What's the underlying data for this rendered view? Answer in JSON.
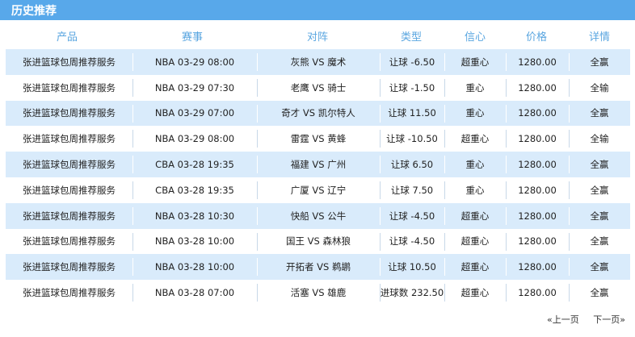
{
  "header": {
    "title": "历史推荐"
  },
  "columns": [
    "产品",
    "赛事",
    "对阵",
    "类型",
    "信心",
    "价格",
    "详情"
  ],
  "rows": [
    {
      "product": "张进篮球包周推荐服务",
      "match": "NBA 03-29 08:00",
      "teams": "灰熊 VS 魔术",
      "type": "让球 -6.50",
      "confidence": "超重心",
      "price": "1280.00",
      "result": "全赢"
    },
    {
      "product": "张进篮球包周推荐服务",
      "match": "NBA 03-29 07:30",
      "teams": "老鹰 VS 骑士",
      "type": "让球 -1.50",
      "confidence": "重心",
      "price": "1280.00",
      "result": "全输"
    },
    {
      "product": "张进篮球包周推荐服务",
      "match": "NBA 03-29 07:00",
      "teams": "奇才 VS 凯尔特人",
      "type": "让球 11.50",
      "confidence": "重心",
      "price": "1280.00",
      "result": "全赢"
    },
    {
      "product": "张进篮球包周推荐服务",
      "match": "NBA 03-29 08:00",
      "teams": "雷霆 VS 黄蜂",
      "type": "让球 -10.50",
      "confidence": "超重心",
      "price": "1280.00",
      "result": "全输"
    },
    {
      "product": "张进篮球包周推荐服务",
      "match": "CBA 03-28 19:35",
      "teams": "福建 VS 广州",
      "type": "让球 6.50",
      "confidence": "重心",
      "price": "1280.00",
      "result": "全赢"
    },
    {
      "product": "张进篮球包周推荐服务",
      "match": "CBA 03-28 19:35",
      "teams": "广厦 VS 辽宁",
      "type": "让球 7.50",
      "confidence": "重心",
      "price": "1280.00",
      "result": "全赢"
    },
    {
      "product": "张进篮球包周推荐服务",
      "match": "NBA 03-28 10:30",
      "teams": "快船 VS 公牛",
      "type": "让球 -4.50",
      "confidence": "超重心",
      "price": "1280.00",
      "result": "全赢"
    },
    {
      "product": "张进篮球包周推荐服务",
      "match": "NBA 03-28 10:00",
      "teams": "国王 VS 森林狼",
      "type": "让球 -4.50",
      "confidence": "超重心",
      "price": "1280.00",
      "result": "全赢"
    },
    {
      "product": "张进篮球包周推荐服务",
      "match": "NBA 03-28 10:00",
      "teams": "开拓者 VS 鹈鹕",
      "type": "让球 10.50",
      "confidence": "超重心",
      "price": "1280.00",
      "result": "全赢"
    },
    {
      "product": "张进篮球包周推荐服务",
      "match": "NBA 03-28 07:00",
      "teams": "活塞 VS 雄鹿",
      "type": "进球数 232.50",
      "confidence": "超重心",
      "price": "1280.00",
      "result": "全赢"
    }
  ],
  "pager": {
    "prev": "«上一页",
    "next": "下一页»"
  }
}
